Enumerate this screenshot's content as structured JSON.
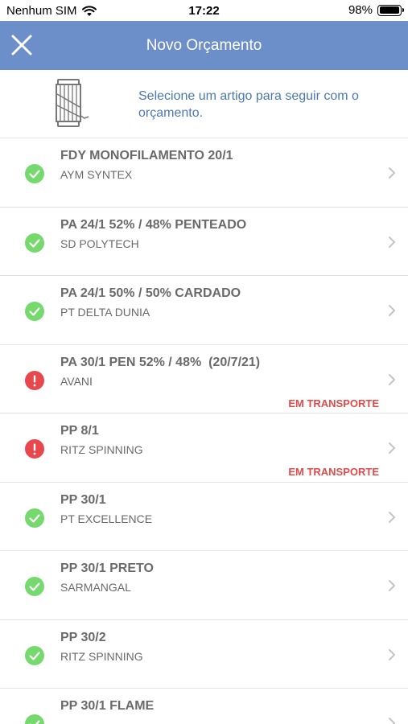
{
  "status_bar": {
    "carrier": "Nenhum SIM",
    "time": "17:22",
    "battery": "98%",
    "battery_level": 0.98
  },
  "nav": {
    "title": "Novo Orçamento",
    "close_icon": "close-icon"
  },
  "intro": {
    "icon": "spool-icon",
    "text": "Selecione um artigo para seguir com o orçamento."
  },
  "colors": {
    "nav_bg": "#6c8ec9",
    "ok": "#76d96d",
    "error": "#e9474e",
    "flag": "#e04a4a",
    "intro_text": "#4a78b5"
  },
  "items": [
    {
      "title": "FDY MONOFILAMENTO 20/1",
      "supplier": "AYM SYNTEX",
      "status": "ok",
      "flag": ""
    },
    {
      "title": "PA 24/1 52% / 48% PENTEADO",
      "supplier": "SD POLYTECH",
      "status": "ok",
      "flag": ""
    },
    {
      "title": "PA 24/1 50% / 50% CARDADO",
      "supplier": "PT DELTA DUNIA",
      "status": "ok",
      "flag": ""
    },
    {
      "title": "PA 30/1 PEN 52% / 48%  (20/7/21)",
      "supplier": "AVANI",
      "status": "error",
      "flag": "EM TRANSPORTE"
    },
    {
      "title": "PP 8/1",
      "supplier": "RITZ SPINNING",
      "status": "error",
      "flag": "EM TRANSPORTE"
    },
    {
      "title": "PP 30/1",
      "supplier": "PT EXCELLENCE",
      "status": "ok",
      "flag": ""
    },
    {
      "title": "PP 30/1 PRETO",
      "supplier": "SARMANGAL",
      "status": "ok",
      "flag": ""
    },
    {
      "title": "PP 30/2",
      "supplier": "RITZ SPINNING",
      "status": "ok",
      "flag": ""
    },
    {
      "title": "PP 30/1 FLAME",
      "supplier": "",
      "status": "ok",
      "flag": ""
    }
  ]
}
